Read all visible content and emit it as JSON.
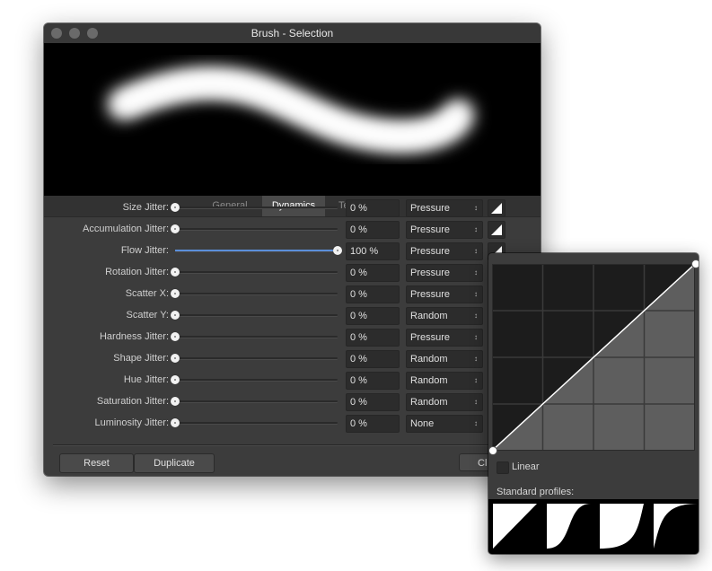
{
  "window": {
    "title": "Brush - Selection"
  },
  "tabs": [
    {
      "label": "General",
      "active": false
    },
    {
      "label": "Dynamics",
      "active": true
    },
    {
      "label": "Texture",
      "active": false
    }
  ],
  "rows": [
    {
      "label": "Size Jitter:",
      "value": "0 %",
      "level": 0,
      "controller": "Pressure",
      "curve_button": true
    },
    {
      "label": "Accumulation Jitter:",
      "value": "0 %",
      "level": 0,
      "controller": "Pressure",
      "curve_button": true
    },
    {
      "label": "Flow Jitter:",
      "value": "100 %",
      "level": 1,
      "controller": "Pressure",
      "curve_button": true
    },
    {
      "label": "Rotation Jitter:",
      "value": "0 %",
      "level": 0,
      "controller": "Pressure",
      "curve_button": false
    },
    {
      "label": "Scatter X:",
      "value": "0 %",
      "level": 0,
      "controller": "Pressure",
      "curve_button": false
    },
    {
      "label": "Scatter Y:",
      "value": "0 %",
      "level": 0,
      "controller": "Random",
      "curve_button": false
    },
    {
      "label": "Hardness Jitter:",
      "value": "0 %",
      "level": 0,
      "controller": "Pressure",
      "curve_button": false
    },
    {
      "label": "Shape Jitter:",
      "value": "0 %",
      "level": 0,
      "controller": "Random",
      "curve_button": false
    },
    {
      "label": "Hue Jitter:",
      "value": "0 %",
      "level": 0,
      "controller": "Random",
      "curve_button": false
    },
    {
      "label": "Saturation Jitter:",
      "value": "0 %",
      "level": 0,
      "controller": "Random",
      "curve_button": false
    },
    {
      "label": "Luminosity Jitter:",
      "value": "0 %",
      "level": 0,
      "controller": "None",
      "curve_button": false
    }
  ],
  "footer": {
    "reset_label": "Reset",
    "duplicate_label": "Duplicate",
    "close_label": "Cl"
  },
  "curve_popover": {
    "linear_label": "Linear",
    "linear_checked": false,
    "standard_profiles_label": "Standard profiles:"
  },
  "colors": {
    "slider_fill": "#5b8fd9",
    "panel_bg": "#3c3c3c"
  }
}
